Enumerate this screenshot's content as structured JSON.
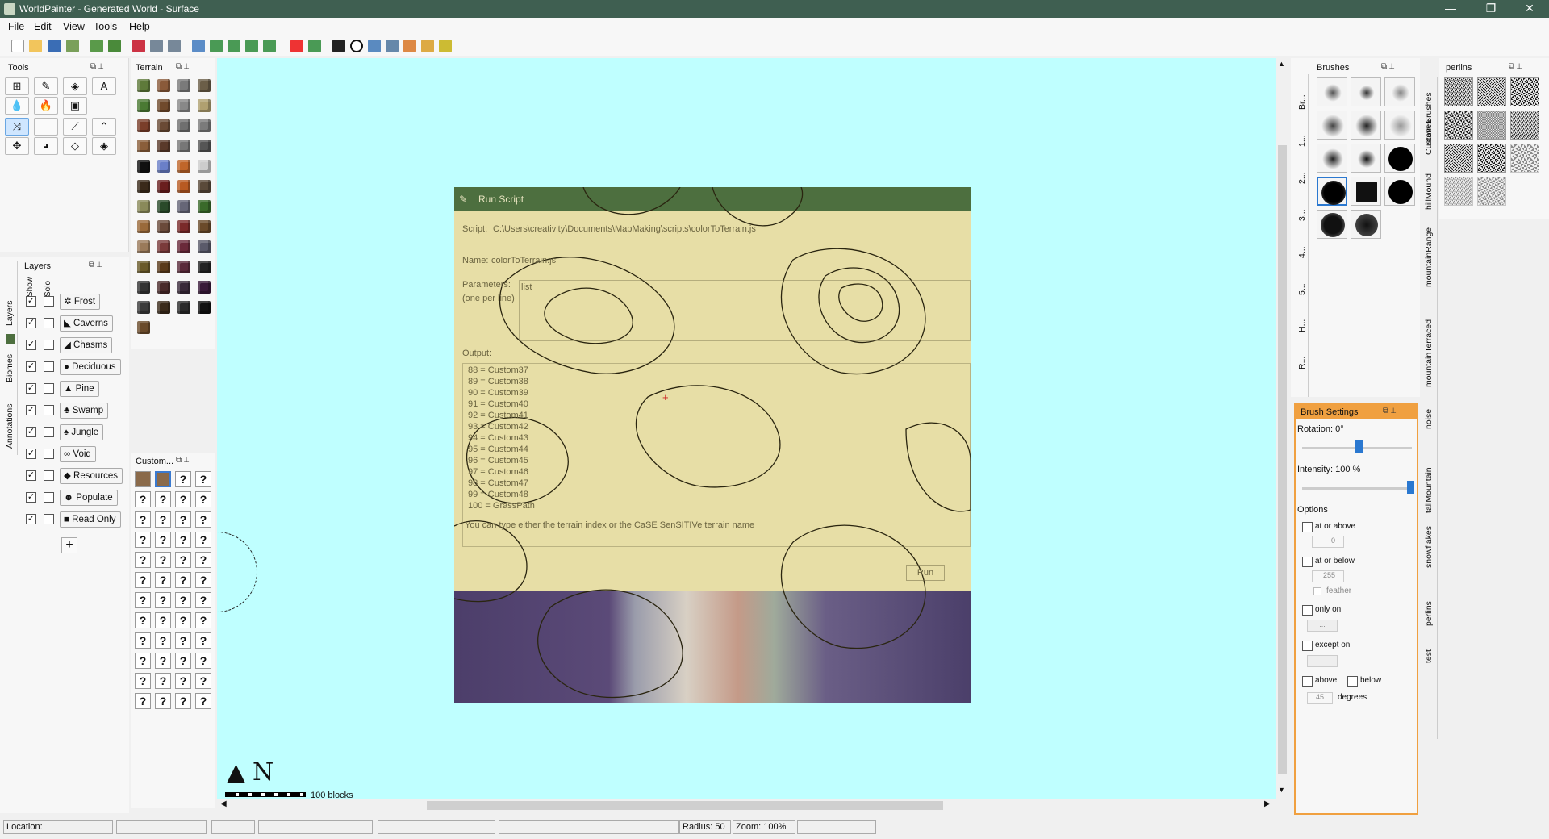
{
  "window": {
    "title": "WorldPainter - Generated World - Surface",
    "controls": [
      "—",
      "❐",
      "✕"
    ]
  },
  "menu": [
    "File",
    "Edit",
    "View",
    "Tools",
    "Help"
  ],
  "panels": {
    "tools": "Tools",
    "terrain": "Terrain",
    "layers": "Layers",
    "custom": "Custom...",
    "brushes": "Brushes",
    "perlins": "perlins",
    "brush_settings": "Brush Settings"
  },
  "layers": {
    "col_show": "Show",
    "col_solo": "Solo",
    "items": [
      {
        "label": "Frost",
        "icon": "snowflake-icon",
        "glyph": "✲"
      },
      {
        "label": "Caverns",
        "icon": "cavern-icon",
        "glyph": "◣"
      },
      {
        "label": "Chasms",
        "icon": "chasm-icon",
        "glyph": "◢"
      },
      {
        "label": "Deciduous",
        "icon": "tree-icon",
        "glyph": "●"
      },
      {
        "label": "Pine",
        "icon": "pine-icon",
        "glyph": "▲"
      },
      {
        "label": "Swamp",
        "icon": "swamp-icon",
        "glyph": "♣"
      },
      {
        "label": "Jungle",
        "icon": "jungle-icon",
        "glyph": "♠"
      },
      {
        "label": "Void",
        "icon": "void-icon",
        "glyph": "∞"
      },
      {
        "label": "Resources",
        "icon": "resources-icon",
        "glyph": "◆"
      },
      {
        "label": "Populate",
        "icon": "populate-icon",
        "glyph": "☻"
      },
      {
        "label": "Read Only",
        "icon": "lock-icon",
        "glyph": "■"
      }
    ],
    "add": "+"
  },
  "left_tabs": [
    "Layers",
    "Biomes",
    "Annotations"
  ],
  "right_tabs": [
    "Custom Brushes",
    "caves",
    "hillMound",
    "mountainRange",
    "mountainTerraced",
    "noise",
    "tallMountain",
    "snowflakes",
    "perlins",
    "test"
  ],
  "brush_tabs": [
    "Br...",
    "1...",
    "2...",
    "3...",
    "4...",
    "5...",
    "H...",
    "R..."
  ],
  "dialog": {
    "title": "Run Script",
    "script_label": "Script:",
    "script_path": "C:\\Users\\creativity\\Documents\\MapMaking\\scripts\\colorToTerrain.js",
    "name_label": "Name:",
    "name_value": "colorToTerrain.js",
    "params_label": "Parameters:",
    "params_hint": "(one per line)",
    "params_value": "list",
    "output_label": "Output:",
    "output_lines": [
      "88 = Custom37",
      "89 = Custom38",
      "90 = Custom39",
      "91 = Custom40",
      "92 = Custom41",
      "93 = Custom42",
      "94 = Custom43",
      "95 = Custom44",
      "96 = Custom45",
      "97 = Custom46",
      "98 = Custom47",
      "99 = Custom48",
      "100 = GrassPath"
    ],
    "hint": "You can type either the terrain index or the CaSE SenSITIVe terrain name",
    "run": "Run"
  },
  "map": {
    "north": "N",
    "scale": "100 blocks"
  },
  "brush_settings": {
    "rotation": "Rotation: 0°",
    "intensity": "Intensity: 100 %",
    "options": "Options",
    "at_or_above": "at or above",
    "at_or_above_value": "0",
    "at_or_below": "at or below",
    "at_or_below_value": "255",
    "feather": "feather",
    "only_on": "only on",
    "except_on": "except on",
    "ellipsis": "...",
    "above": "above",
    "below": "below",
    "degrees_value": "45",
    "degrees": "degrees"
  },
  "status": {
    "location": "Location:",
    "radius": "Radius: 50",
    "zoom": "Zoom: 100%"
  },
  "colors": {
    "titlebar": "#3f5f51",
    "map_bg": "#bfffff",
    "accent": "#f0a040"
  }
}
